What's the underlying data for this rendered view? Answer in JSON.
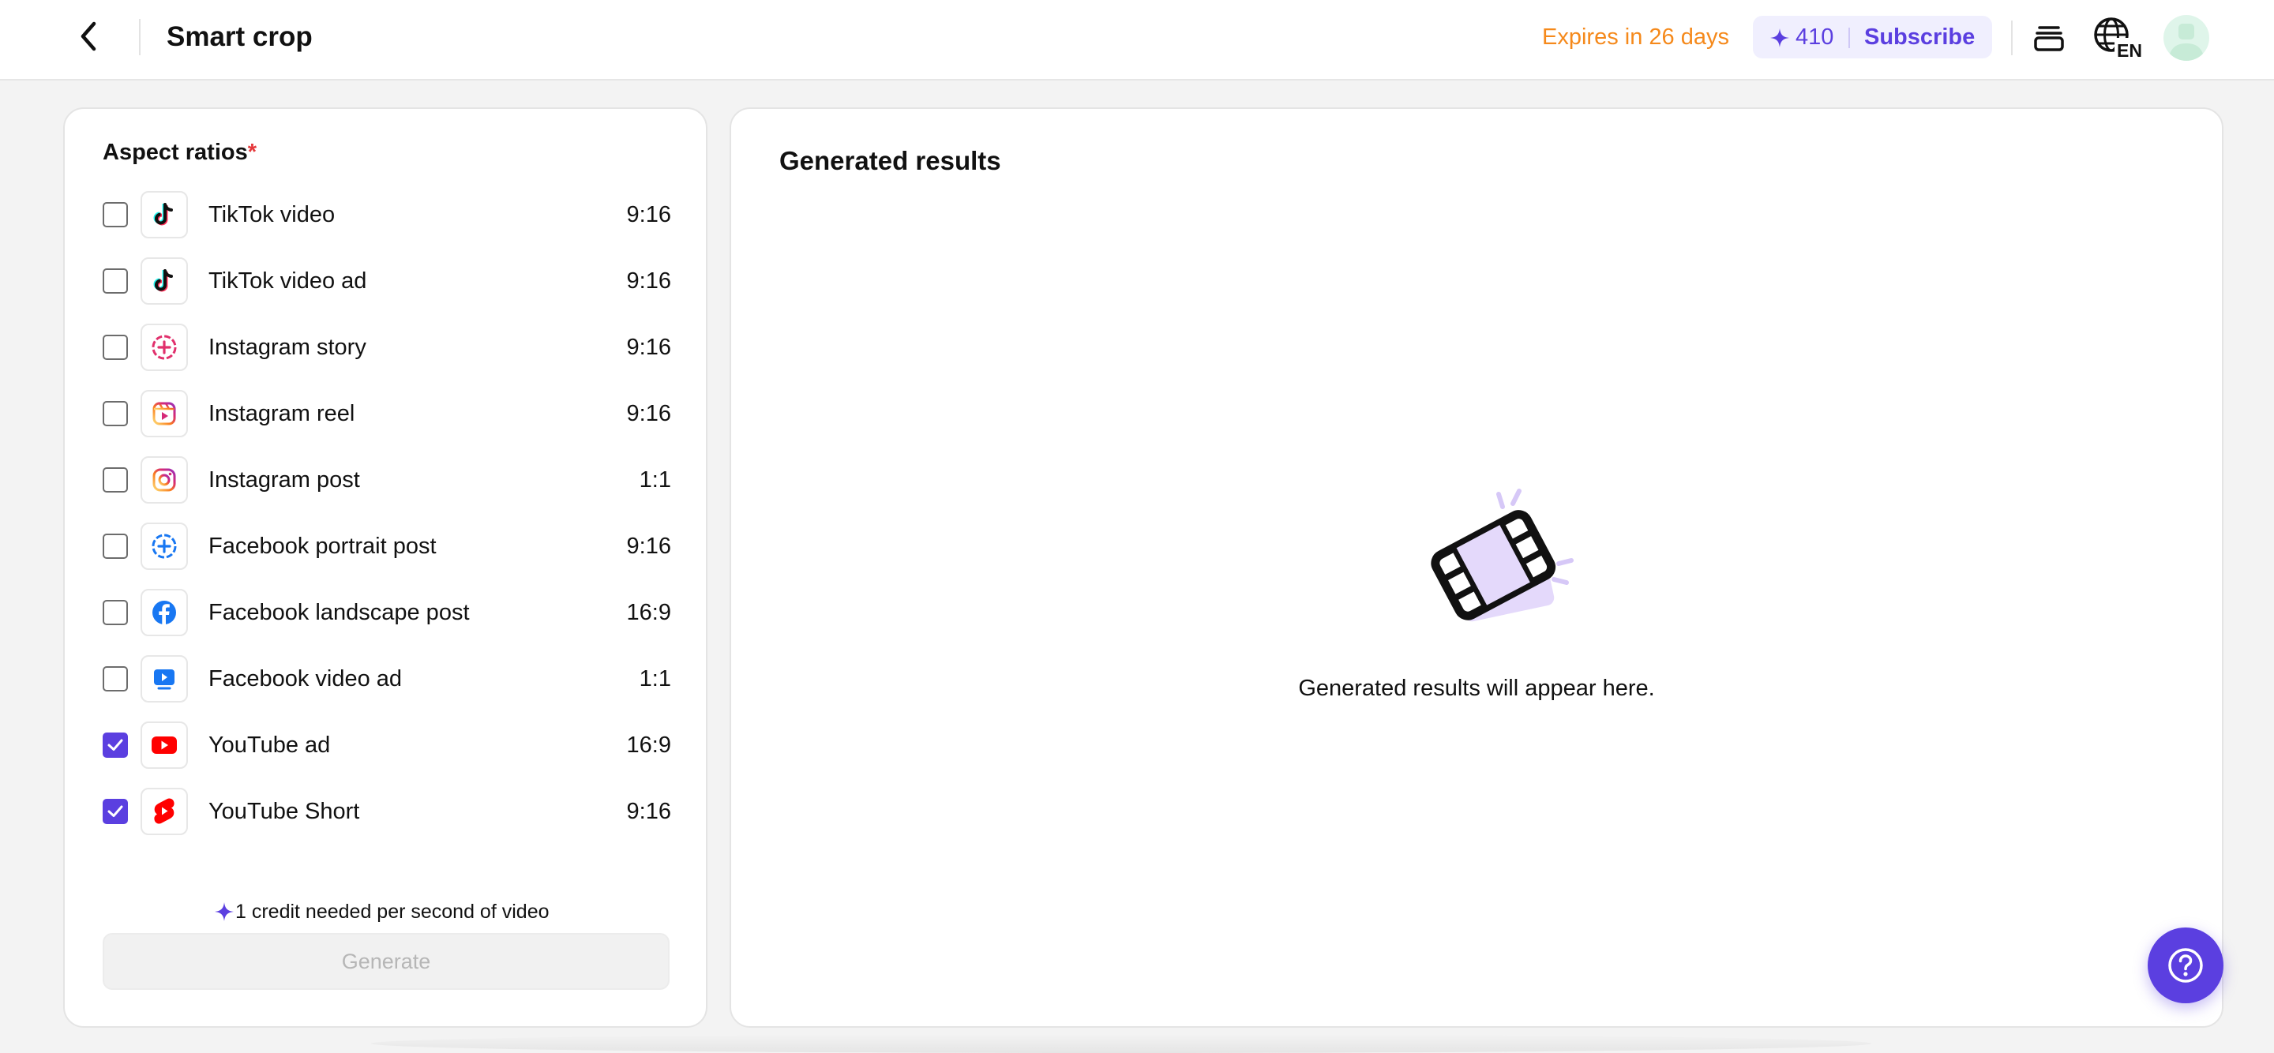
{
  "header": {
    "title": "Smart crop",
    "expires": "Expires in 26 days",
    "credits": "410",
    "subscribe": "Subscribe",
    "language": "EN"
  },
  "aspect": {
    "label": "Aspect ratios",
    "required_mark": "*",
    "items": [
      {
        "name": "TikTok video",
        "ratio": "9:16",
        "checked": false,
        "icon": "tiktok-icon"
      },
      {
        "name": "TikTok video ad",
        "ratio": "9:16",
        "checked": false,
        "icon": "tiktok-icon"
      },
      {
        "name": "Instagram story",
        "ratio": "9:16",
        "checked": false,
        "icon": "instagram-story-icon"
      },
      {
        "name": "Instagram reel",
        "ratio": "9:16",
        "checked": false,
        "icon": "instagram-reel-icon"
      },
      {
        "name": "Instagram post",
        "ratio": "1:1",
        "checked": false,
        "icon": "instagram-icon"
      },
      {
        "name": "Facebook portrait post",
        "ratio": "9:16",
        "checked": false,
        "icon": "facebook-story-icon"
      },
      {
        "name": "Facebook landscape post",
        "ratio": "16:9",
        "checked": false,
        "icon": "facebook-icon"
      },
      {
        "name": "Facebook video ad",
        "ratio": "1:1",
        "checked": false,
        "icon": "facebook-video-icon"
      },
      {
        "name": "YouTube ad",
        "ratio": "16:9",
        "checked": true,
        "icon": "youtube-icon"
      },
      {
        "name": "YouTube Short",
        "ratio": "9:16",
        "checked": true,
        "icon": "youtube-shorts-icon"
      }
    ],
    "credit_note": "1 credit needed per second of video",
    "generate_label": "Generate"
  },
  "results": {
    "title": "Generated results",
    "empty_text": "Generated results will appear here."
  },
  "colors": {
    "accent": "#5b3fe0",
    "expires": "#f5891b",
    "required": "#e5383b"
  }
}
